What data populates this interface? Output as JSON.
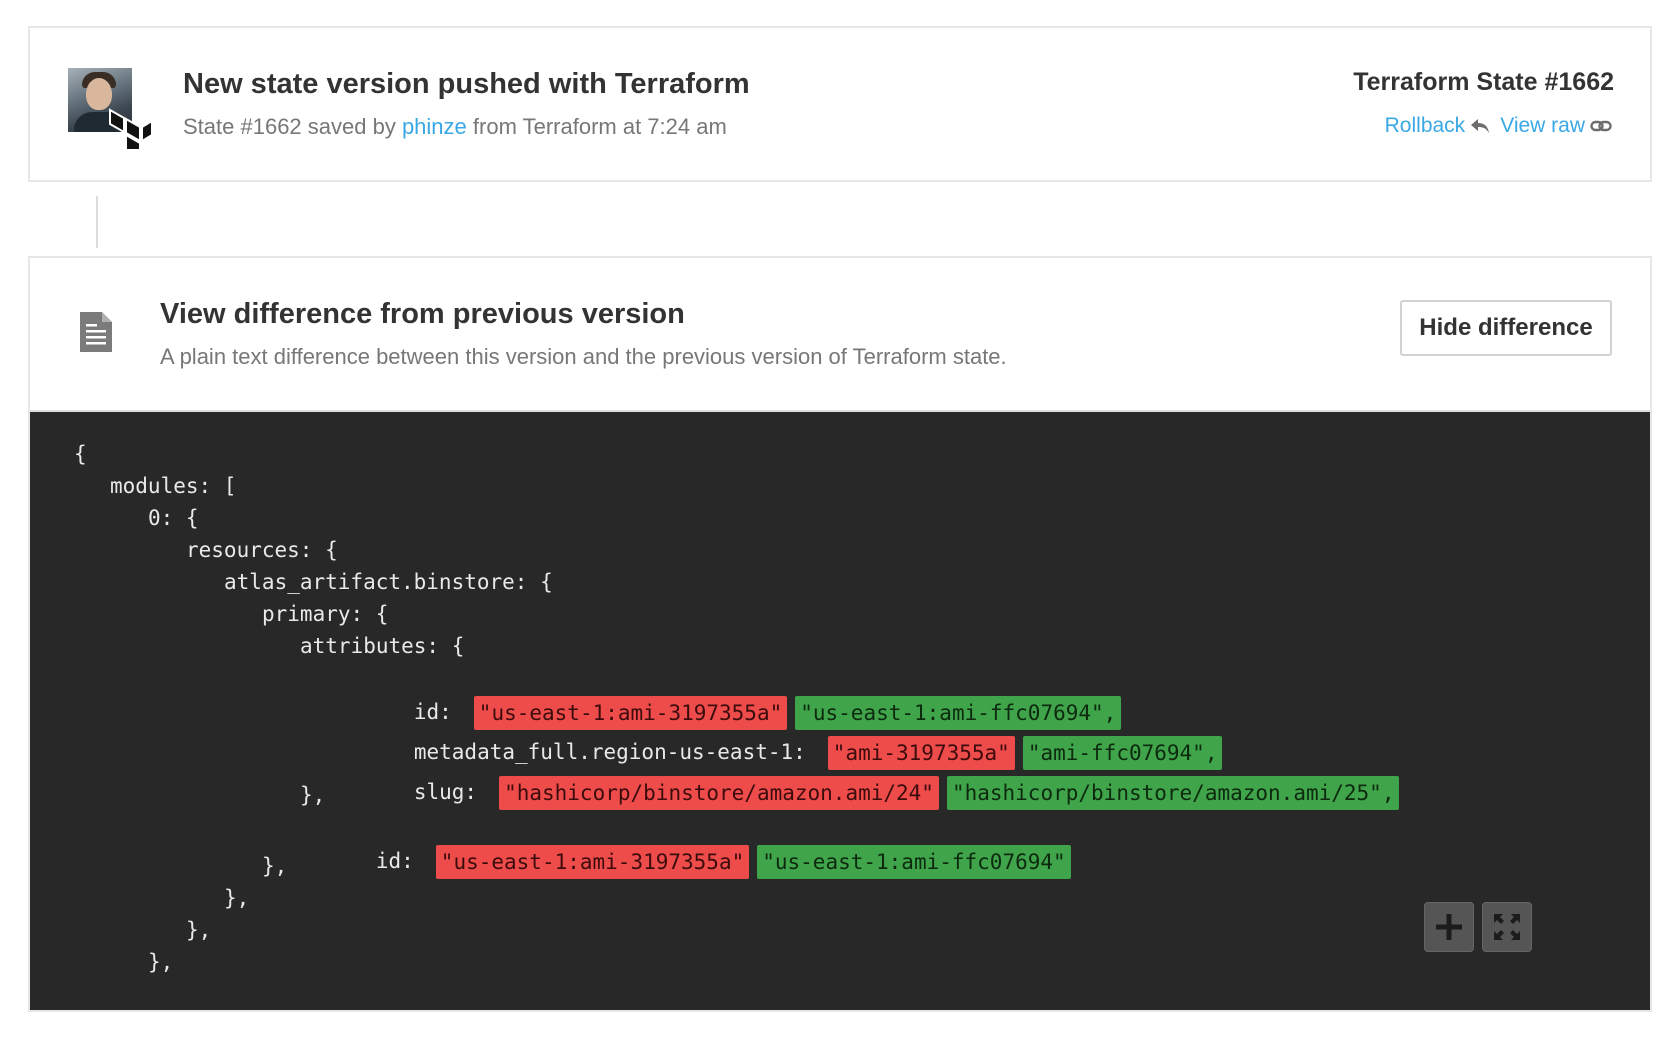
{
  "event": {
    "title": "New state version pushed with Terraform",
    "sub_prefix": "State #1662 saved by ",
    "user": "phinze",
    "sub_suffix": " from Terraform at 7:24 am"
  },
  "state": {
    "title": "Terraform State #1662",
    "rollback_label": "Rollback",
    "view_raw_label": "View raw"
  },
  "diff": {
    "title": "View difference from previous version",
    "description": "A plain text difference between this version and the previous version of Terraform state.",
    "hide_button": "Hide difference"
  },
  "code": {
    "l1": "{",
    "l2": "modules: [",
    "l3": "0: {",
    "l4": "resources: {",
    "l5": "atlas_artifact.binstore: {",
    "l6": "primary: {",
    "l7": "attributes: {",
    "id_key": "id:",
    "id_old": "\"us-east-1:ami-3197355a\"",
    "id_new": "\"us-east-1:ami-ffc07694\",",
    "meta_key": "metadata_full.region-us-east-1:",
    "meta_old": "\"ami-3197355a\"",
    "meta_new": "\"ami-ffc07694\",",
    "slug_key": "slug:",
    "slug_old": "\"hashicorp/binstore/amazon.ami/24\"",
    "slug_new": "\"hashicorp/binstore/amazon.ami/25\",",
    "close_attrs": "},",
    "pid_key": "id:",
    "pid_old": "\"us-east-1:ami-3197355a\"",
    "pid_new": "\"us-east-1:ami-ffc07694\"",
    "close_primary": "},",
    "close_binstore": "},",
    "close_resources": "},",
    "close_module": "},"
  },
  "icons": {
    "avatar": "user-avatar",
    "terraform": "terraform-logo-icon",
    "rollback": "reply-arrow-icon",
    "view_raw": "link-icon",
    "document": "document-icon",
    "zoom_in": "plus-icon",
    "fullscreen": "expand-icon"
  },
  "colors": {
    "link": "#3aa8e6",
    "removed": "#ee4b4b",
    "added": "#3fa44a",
    "code_bg": "#282828"
  }
}
